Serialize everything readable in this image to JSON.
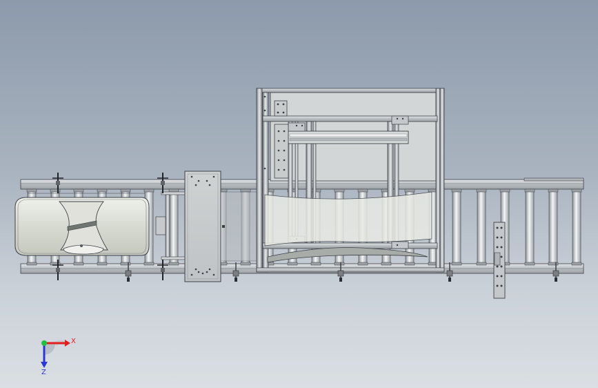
{
  "scene": {
    "background_top": "#8c9aab",
    "background_bottom": "#dadfe4",
    "metal_color": "#c9cdcf",
    "edge_color": "#3c4046"
  },
  "triad": {
    "x_label": "X",
    "z_label": "Z",
    "x_color": "#e02020",
    "z_color": "#2a36d8",
    "origin_color": "#20c040"
  }
}
